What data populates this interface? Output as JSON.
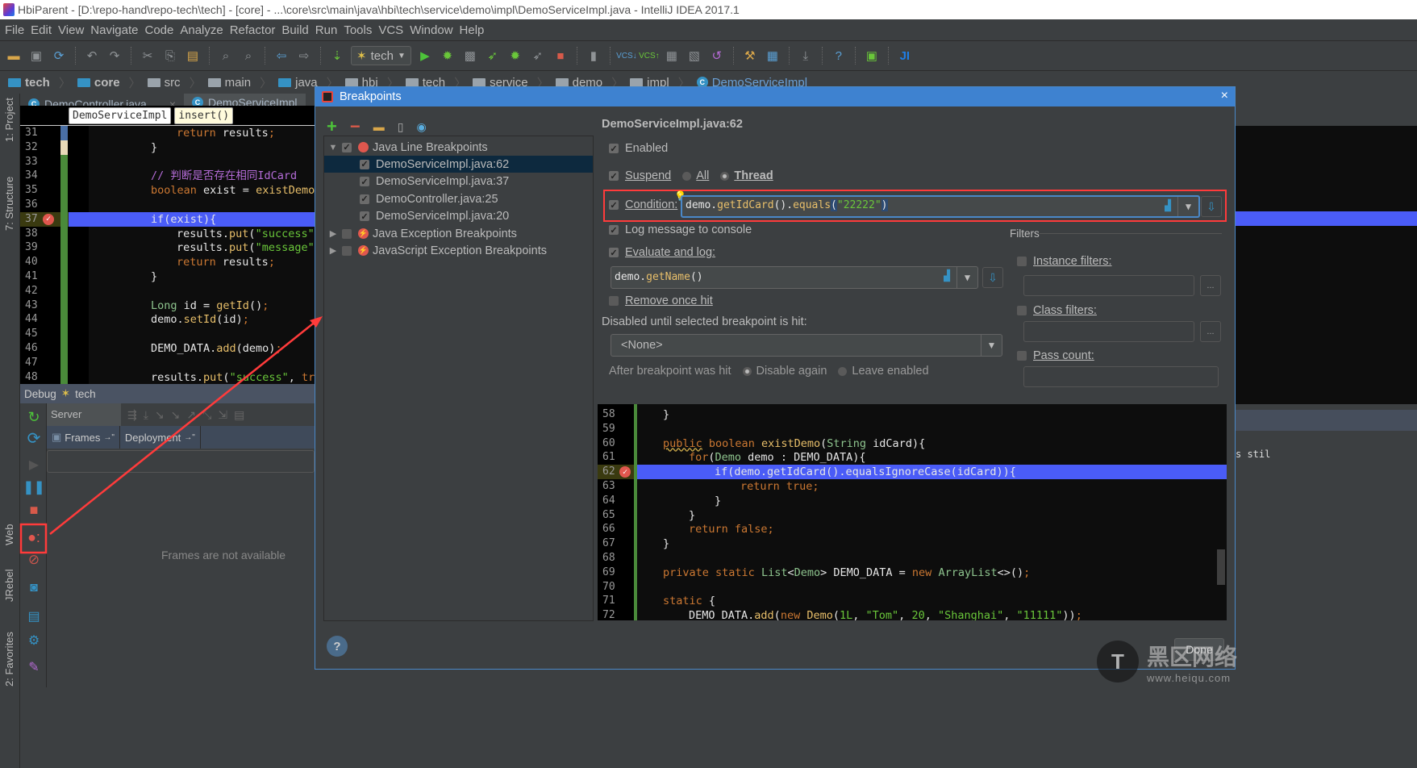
{
  "window": {
    "title": "HbiParent - [D:\\repo-hand\\repo-tech\\tech] - [core] - ...\\core\\src\\main\\java\\hbi\\tech\\service\\demo\\impl\\DemoServiceImpl.java - IntelliJ IDEA 2017.1"
  },
  "menu": [
    "File",
    "Edit",
    "View",
    "Navigate",
    "Code",
    "Analyze",
    "Refactor",
    "Build",
    "Run",
    "Tools",
    "VCS",
    "Window",
    "Help"
  ],
  "toolbar": {
    "run_config": "tech"
  },
  "navbar": {
    "crumbs": [
      "tech",
      "core",
      "src",
      "main",
      "java",
      "hbi",
      "tech",
      "service",
      "demo",
      "impl",
      "DemoServiceImpl"
    ]
  },
  "left_stripe": {
    "project": "1: Project",
    "structure": "7: Structure",
    "web": "Web",
    "jrebel": "JRebel",
    "favorites": "2: Favorites"
  },
  "editor": {
    "tabs": [
      {
        "label": "DemoController.java"
      },
      {
        "label": "DemoServiceImpl"
      }
    ],
    "crumb_class": "DemoServiceImpl",
    "crumb_method": "insert()",
    "lines": [
      {
        "n": "31",
        "html": "<span class='kw'>return</span> results<span class='kw'>;</span>",
        "indent": 2
      },
      {
        "n": "32",
        "html": "}",
        "indent": 1
      },
      {
        "n": "33",
        "html": "",
        "indent": 1
      },
      {
        "n": "34",
        "html": "<span class='cm'>// 判断是否存在相同IdCard</span>",
        "indent": 1
      },
      {
        "n": "35",
        "html": "<span class='kw'>boolean</span> exist = <span class='fn'>existDemo</span>(dem",
        "indent": 1
      },
      {
        "n": "36",
        "html": "",
        "indent": 1
      },
      {
        "n": "37",
        "html": "if(exist){",
        "indent": 1,
        "hl": true
      },
      {
        "n": "38",
        "html": "results.<span class='fn'>put</span>(<span class='str'>\"success\"</span>, <span class='kw'>fa</span>",
        "indent": 2
      },
      {
        "n": "39",
        "html": "results.<span class='fn'>put</span>(<span class='str'>\"message\"</span>, <span class='str'>\"I</span>",
        "indent": 2
      },
      {
        "n": "40",
        "html": "<span class='kw'>return</span> results<span class='kw'>;</span>",
        "indent": 2
      },
      {
        "n": "41",
        "html": "}",
        "indent": 1
      },
      {
        "n": "42",
        "html": "",
        "indent": 1
      },
      {
        "n": "43",
        "html": "<span class='ty'>Long</span> id = <span class='fn'>getId</span>()<span class='kw'>;</span>",
        "indent": 1
      },
      {
        "n": "44",
        "html": "demo.<span class='fn'>setId</span>(id)<span class='kw'>;</span>",
        "indent": 1
      },
      {
        "n": "45",
        "html": "",
        "indent": 1
      },
      {
        "n": "46",
        "html": "DEMO_DATA.<span class='fn'>add</span>(demo)<span class='kw'>;</span>",
        "indent": 1
      },
      {
        "n": "47",
        "html": "",
        "indent": 1
      },
      {
        "n": "48",
        "html": "results.<span class='fn'>put</span>(<span class='str'>\"success\"</span>, <span class='kw'>true</span>)<span class='kw'>;</span>",
        "indent": 1
      }
    ]
  },
  "debug": {
    "title": "Debug",
    "config": "tech",
    "server_tab": "Server",
    "frames_tab": "Frames",
    "deployment_tab": "Deployment",
    "frames_empty": "Frames are not available"
  },
  "dialog": {
    "title": "Breakpoints",
    "close": "×",
    "tree": [
      {
        "label": "Java Line Breakpoints",
        "level": 0,
        "expanded": true,
        "checked": true,
        "icon": "red-dot"
      },
      {
        "label": "DemoServiceImpl.java:62",
        "level": 1,
        "checked": true,
        "selected": true
      },
      {
        "label": "DemoServiceImpl.java:37",
        "level": 1,
        "checked": true
      },
      {
        "label": "DemoController.java:25",
        "level": 1,
        "checked": true
      },
      {
        "label": "DemoServiceImpl.java:20",
        "level": 1,
        "checked": true
      },
      {
        "label": "Java Exception Breakpoints",
        "level": 0,
        "expanded": false,
        "checked": false,
        "icon": "exception"
      },
      {
        "label": "JavaScript Exception Breakpoints",
        "level": 0,
        "expanded": false,
        "checked": false,
        "icon": "exception"
      }
    ],
    "props": {
      "header": "DemoServiceImpl.java:62",
      "enabled": "Enabled",
      "suspend": "Suspend",
      "suspend_all": "All",
      "suspend_thread": "Thread",
      "suspend_policy": "Thread",
      "condition_label": "Condition:",
      "condition_value_html": "<span class='wt'>demo.</span><span class='fn'>getIdCard</span><span class='wt'>().</span><span class='fn'>equals</span><span class='wt' style='background:#2d4b73'>(</span><span class='str'>\"22222\"</span><span class='wt' style='background:#2d4b73'>)</span>",
      "log_message": "Log message to console",
      "evaluate_log": "Evaluate and log:",
      "evaluate_value_html": "<span class='wt'>demo.</span><span class='fn'>getName</span><span class='wt'>()</span>",
      "remove_once_hit": "Remove once hit",
      "disabled_until": "Disabled until selected breakpoint is hit:",
      "disabled_until_value": "<None>",
      "after_hit": "After breakpoint was hit",
      "disable_again": "Disable again",
      "leave_enabled": "Leave enabled",
      "filters": "Filters",
      "instance_filters": "Instance filters:",
      "class_filters": "Class filters:",
      "pass_count": "Pass count:",
      "ellipsis": "..."
    },
    "preview_lines": [
      {
        "n": "58",
        "html": "}",
        "indent": 0
      },
      {
        "n": "59",
        "html": "",
        "indent": 0
      },
      {
        "n": "60",
        "html": "<span class='kw' style='text-decoration:underline wavy #c9a84a'>public</span> <span class='kw'>boolean</span> <span class='fn'>existDemo</span>(<span class='ty'>String</span> idCard){",
        "indent": 0
      },
      {
        "n": "61",
        "html": "<span class='kw'>for</span>(<span class='ty'>Demo</span> demo : DEMO_DATA){",
        "indent": 1
      },
      {
        "n": "62",
        "html": "if(demo.getIdCard().equalsIgnoreCase(idCard)){",
        "indent": 2,
        "hl": true
      },
      {
        "n": "63",
        "html": "<span class='kw'>return true;</span>",
        "indent": 3
      },
      {
        "n": "64",
        "html": "}",
        "indent": 2
      },
      {
        "n": "65",
        "html": "}",
        "indent": 1
      },
      {
        "n": "66",
        "html": "<span class='kw'>return false;</span>",
        "indent": 1
      },
      {
        "n": "67",
        "html": "}",
        "indent": 0
      },
      {
        "n": "68",
        "html": "",
        "indent": 0
      },
      {
        "n": "69",
        "html": "<span class='kw'>private static</span> <span class='ty'>List</span>&lt;<span class='ty'>Demo</span>&gt; DEMO_DATA = <span class='kw'>new</span> <span class='ty'>ArrayList</span>&lt;&gt;()<span class='kw'>;</span>",
        "indent": 0
      },
      {
        "n": "70",
        "html": "",
        "indent": 0
      },
      {
        "n": "71",
        "html": "<span class='kw'>static</span> {",
        "indent": 0
      },
      {
        "n": "72",
        "html": "DEMO_DATA.<span class='fn'>add</span>(<span class='kw'>new</span> <span class='fn'>Demo</span>(<span class='str'>1L</span>, <span class='str'>\"Tom\"</span>, <span class='str'>20</span>, <span class='str'>\"Shanghai\"</span>, <span class='str'>\"11111\"</span>))<span class='kw'>;</span>",
        "indent": 1
      }
    ],
    "help": "?",
    "done": "Done"
  },
  "right_edge_text": "s stil",
  "watermark": {
    "title": "黑区网络",
    "url": "www.heiqu.com"
  },
  "colors": {
    "accent": "#3e82d0",
    "highlight_line": "#4a5cf7",
    "annotation": "#ff3b3b",
    "selection": "#0d293e"
  }
}
